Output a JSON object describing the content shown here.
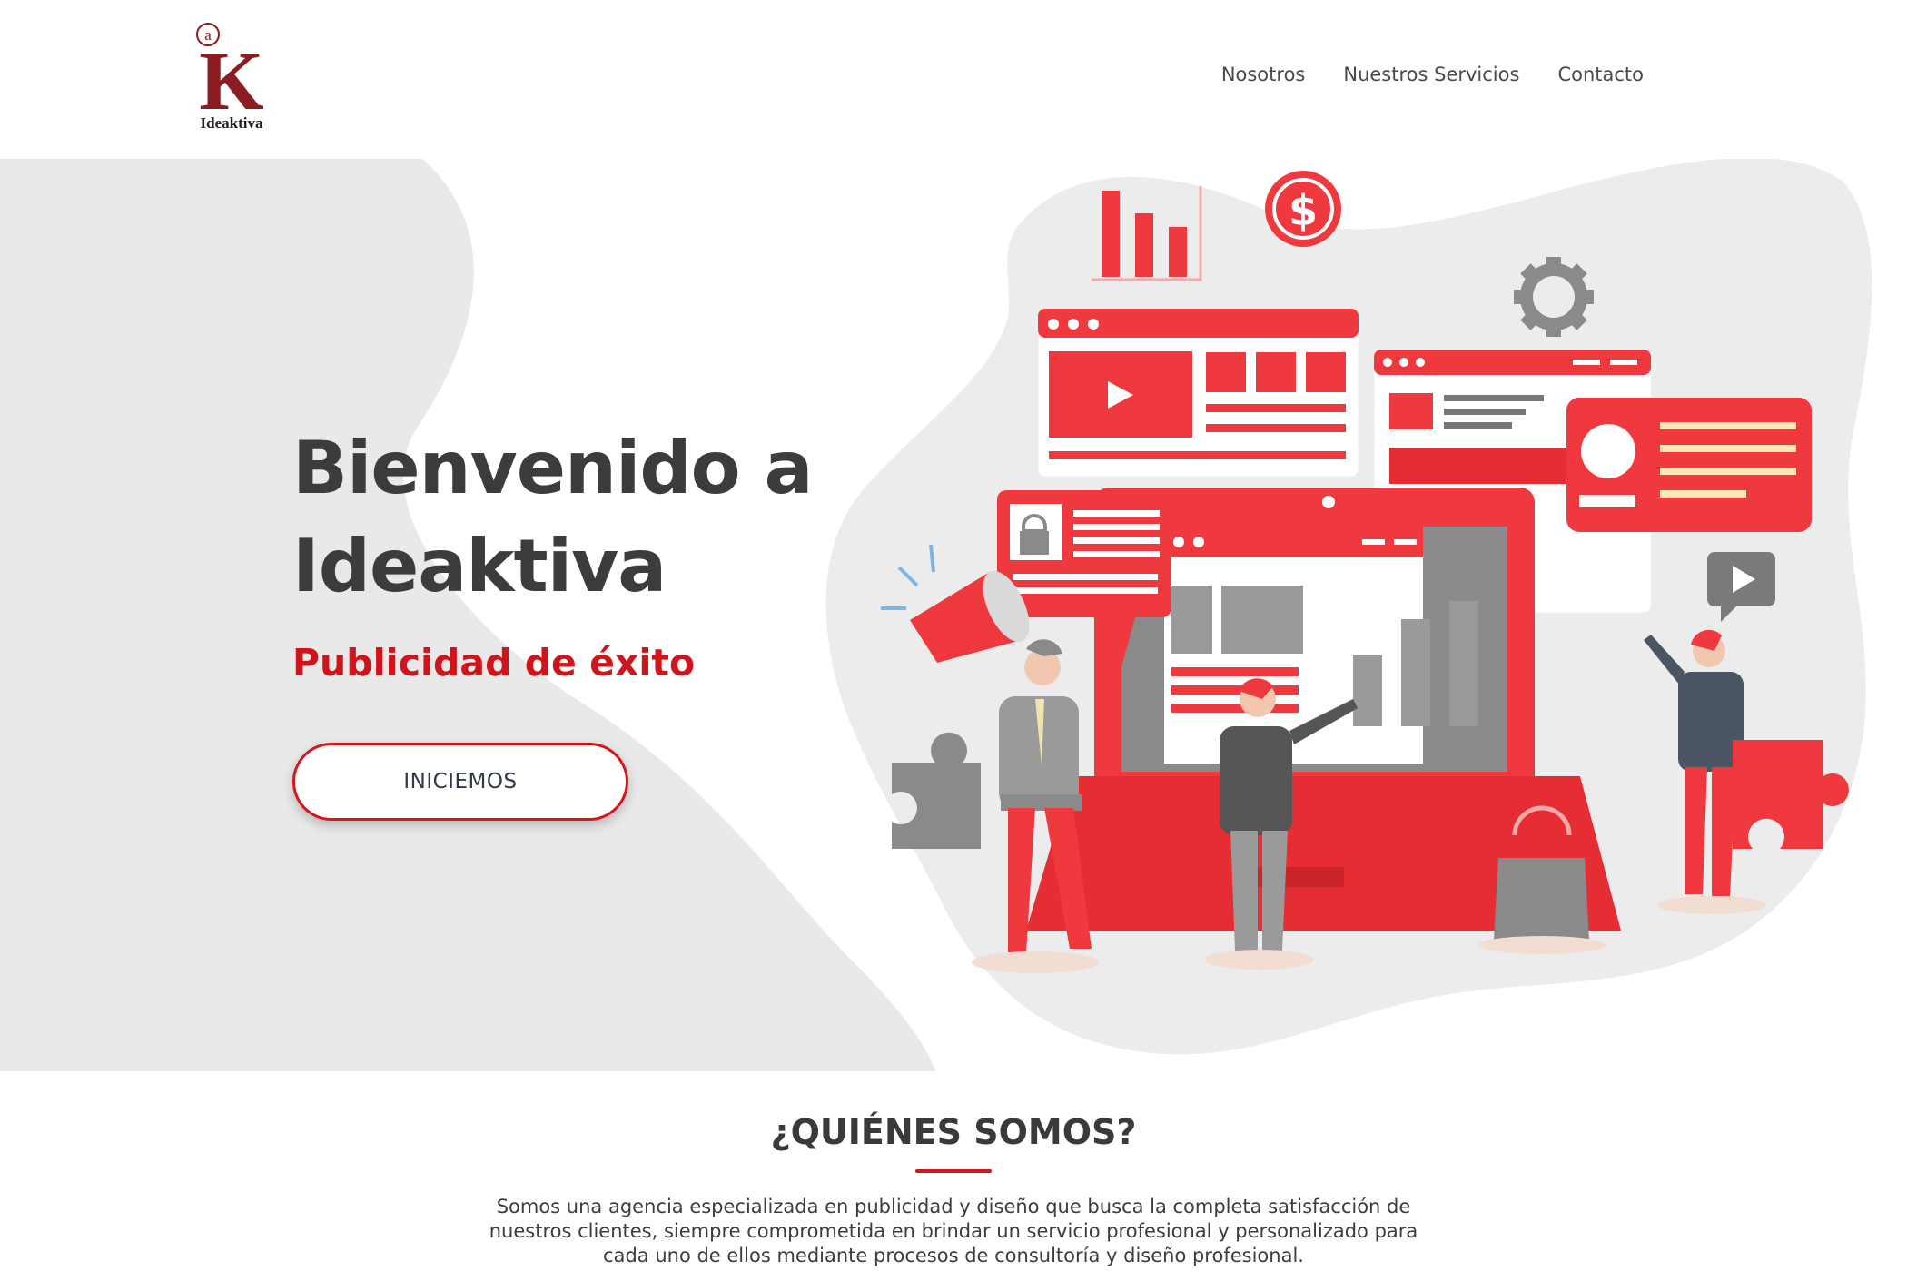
{
  "brand": {
    "logo_letter_small": "a",
    "logo_letter_big": "K",
    "logo_wordmark": "Ideaktiva"
  },
  "nav": {
    "items": [
      "Nosotros",
      "Nuestros Servicios",
      "Contacto"
    ]
  },
  "hero": {
    "title_line1": "Bienvenido a",
    "title_line2": "Ideaktiva",
    "subtitle": "Publicidad de éxito",
    "cta_label": "INICIEMOS"
  },
  "about": {
    "title": "¿QUIÉNES SOMOS?",
    "text": "Somos una agencia especializada en publicidad y diseño que busca la completa satisfacción de nuestros clientes, siempre comprometida en brindar un servicio profesional y personalizado para cada uno de ellos mediante procesos de consultoría y diseño profesional."
  },
  "colors": {
    "accent": "#d8151b",
    "heading": "#3c3c3c",
    "panel_gray": "#e9e9e9",
    "illus_red": "#f0393e",
    "illus_gray": "#8a8a8a"
  },
  "icons": [
    "dollar-icon",
    "gear-icon",
    "bar-chart-icon",
    "play-icon",
    "megaphone-icon",
    "lock-icon",
    "puzzle-icon",
    "shopping-bag-icon"
  ]
}
